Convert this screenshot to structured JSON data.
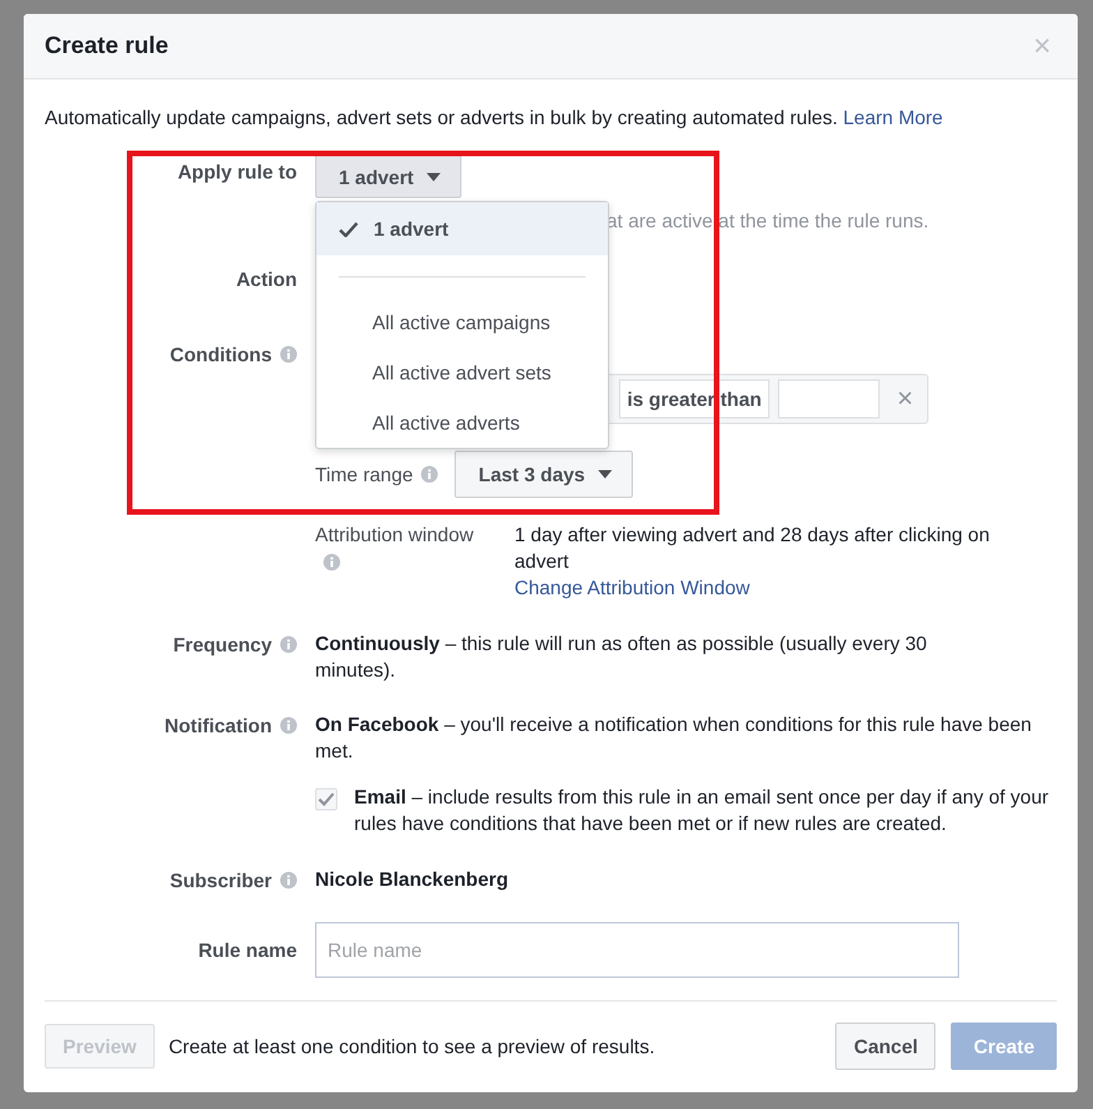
{
  "dialog": {
    "title": "Create rule",
    "close": "×",
    "intro": "Automatically update campaigns, advert sets or adverts in bulk by creating automated rules.",
    "learn_more": "Learn More"
  },
  "apply_rule": {
    "label": "Apply rule to",
    "value": "1 advert",
    "hint": "at are active at the time the rule runs.",
    "menu": [
      {
        "kind": "option",
        "label": "1 advert",
        "selected": true
      },
      {
        "kind": "divider"
      },
      {
        "kind": "option",
        "label": "All active campaigns",
        "selected": false
      },
      {
        "kind": "option",
        "label": "All active advert sets",
        "selected": false
      },
      {
        "kind": "option",
        "label": "All active adverts",
        "selected": false
      }
    ]
  },
  "action": {
    "label": "Action"
  },
  "conditions": {
    "label": "Conditions",
    "operator": "is greater than",
    "remove": "×"
  },
  "time_range": {
    "label": "Time range",
    "value": "Last 3 days"
  },
  "attribution": {
    "label": "Attribution window",
    "text": "1 day after viewing advert and 28 days after clicking on advert",
    "link": "Change Attribution Window"
  },
  "frequency": {
    "label": "Frequency",
    "text": "**Continuously** – this rule will run as often as possible (usually every 30 minutes)."
  },
  "notification": {
    "label": "Notification",
    "text": "**On Facebook** – you'll receive a notification when conditions for this rule have been met.",
    "email": {
      "checked": true,
      "text": "**Email** – include results from this rule in an email sent once per day if any of your rules have conditions that have been met or if new rules are created."
    }
  },
  "subscriber": {
    "label": "Subscriber",
    "name": "Nicole Blanckenberg"
  },
  "rule_name": {
    "label": "Rule name",
    "placeholder": "Rule name"
  },
  "footer": {
    "preview": {
      "label": "Preview",
      "disabled": true
    },
    "note": "Create at least one condition to see a preview of results.",
    "cancel": "Cancel",
    "create": {
      "label": "Create",
      "disabled": true
    }
  }
}
